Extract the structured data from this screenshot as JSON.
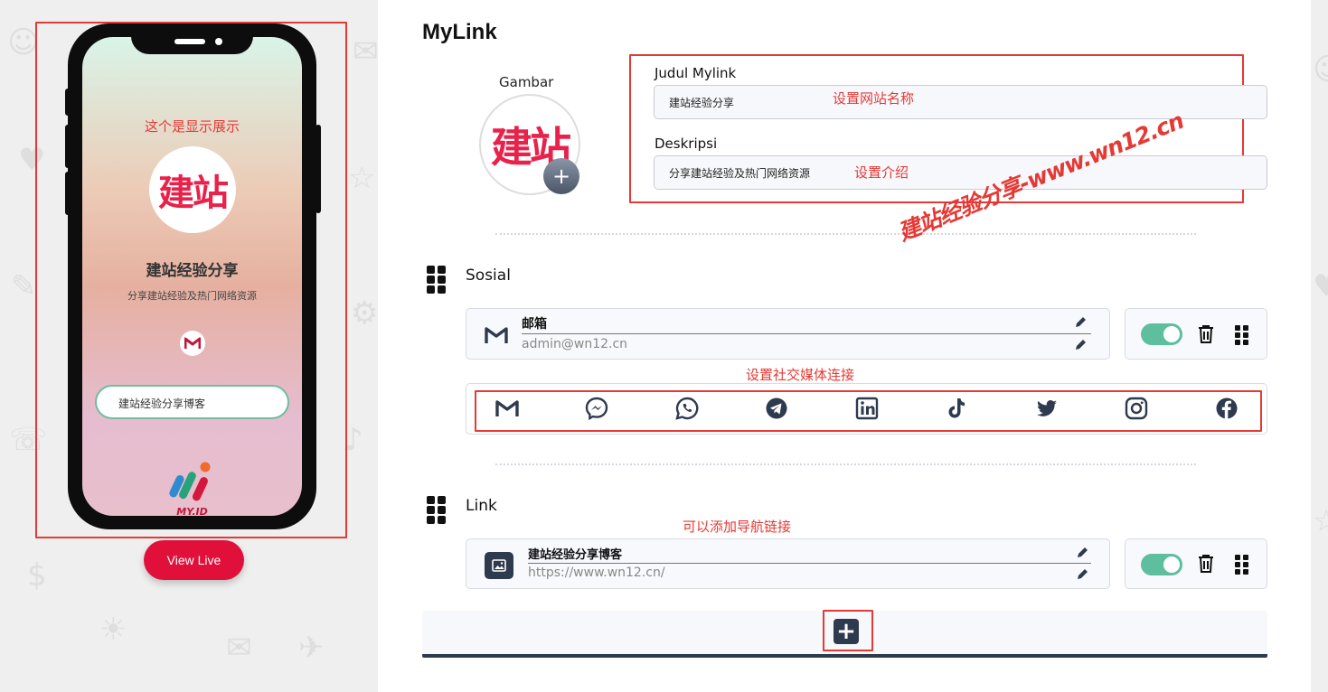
{
  "preview": {
    "hint": "这个是显示展示",
    "avatar_text": "建站",
    "site_title": "建站经验分享",
    "site_desc": "分享建站经验及热门网络资源",
    "link_button": "建站经验分享博客",
    "brand_text": "MY.ID",
    "view_live": "View Live"
  },
  "editor": {
    "title": "MyLink",
    "image_label": "Gambar",
    "avatar_text": "建站",
    "title_label": "Judul Mylink",
    "title_value": "建站经验分享",
    "title_annotation": "设置网站名称",
    "desc_label": "Deskripsi",
    "desc_value": "分享建站经验及热门网络资源",
    "desc_annotation": "设置介绍",
    "watermark": "建站经验分享-www.wn12.cn",
    "social": {
      "section_title": "Sosial",
      "item_title": "邮箱",
      "item_value": "admin@wn12.cn",
      "icons_annotation": "设置社交媒体连接",
      "icons": [
        "gmail",
        "messenger",
        "whatsapp",
        "telegram",
        "linkedin",
        "tiktok",
        "twitter",
        "instagram",
        "facebook"
      ]
    },
    "link": {
      "section_title": "Link",
      "annotation": "可以添加导航链接",
      "item_title": "建站经验分享博客",
      "item_url": "https://www.wn12.cn/"
    },
    "add_label": "+"
  },
  "colors": {
    "accent_red": "#e0103a",
    "toggle_on": "#5dbf9d",
    "annotation": "#e53935",
    "dark": "#2e3a4e"
  }
}
